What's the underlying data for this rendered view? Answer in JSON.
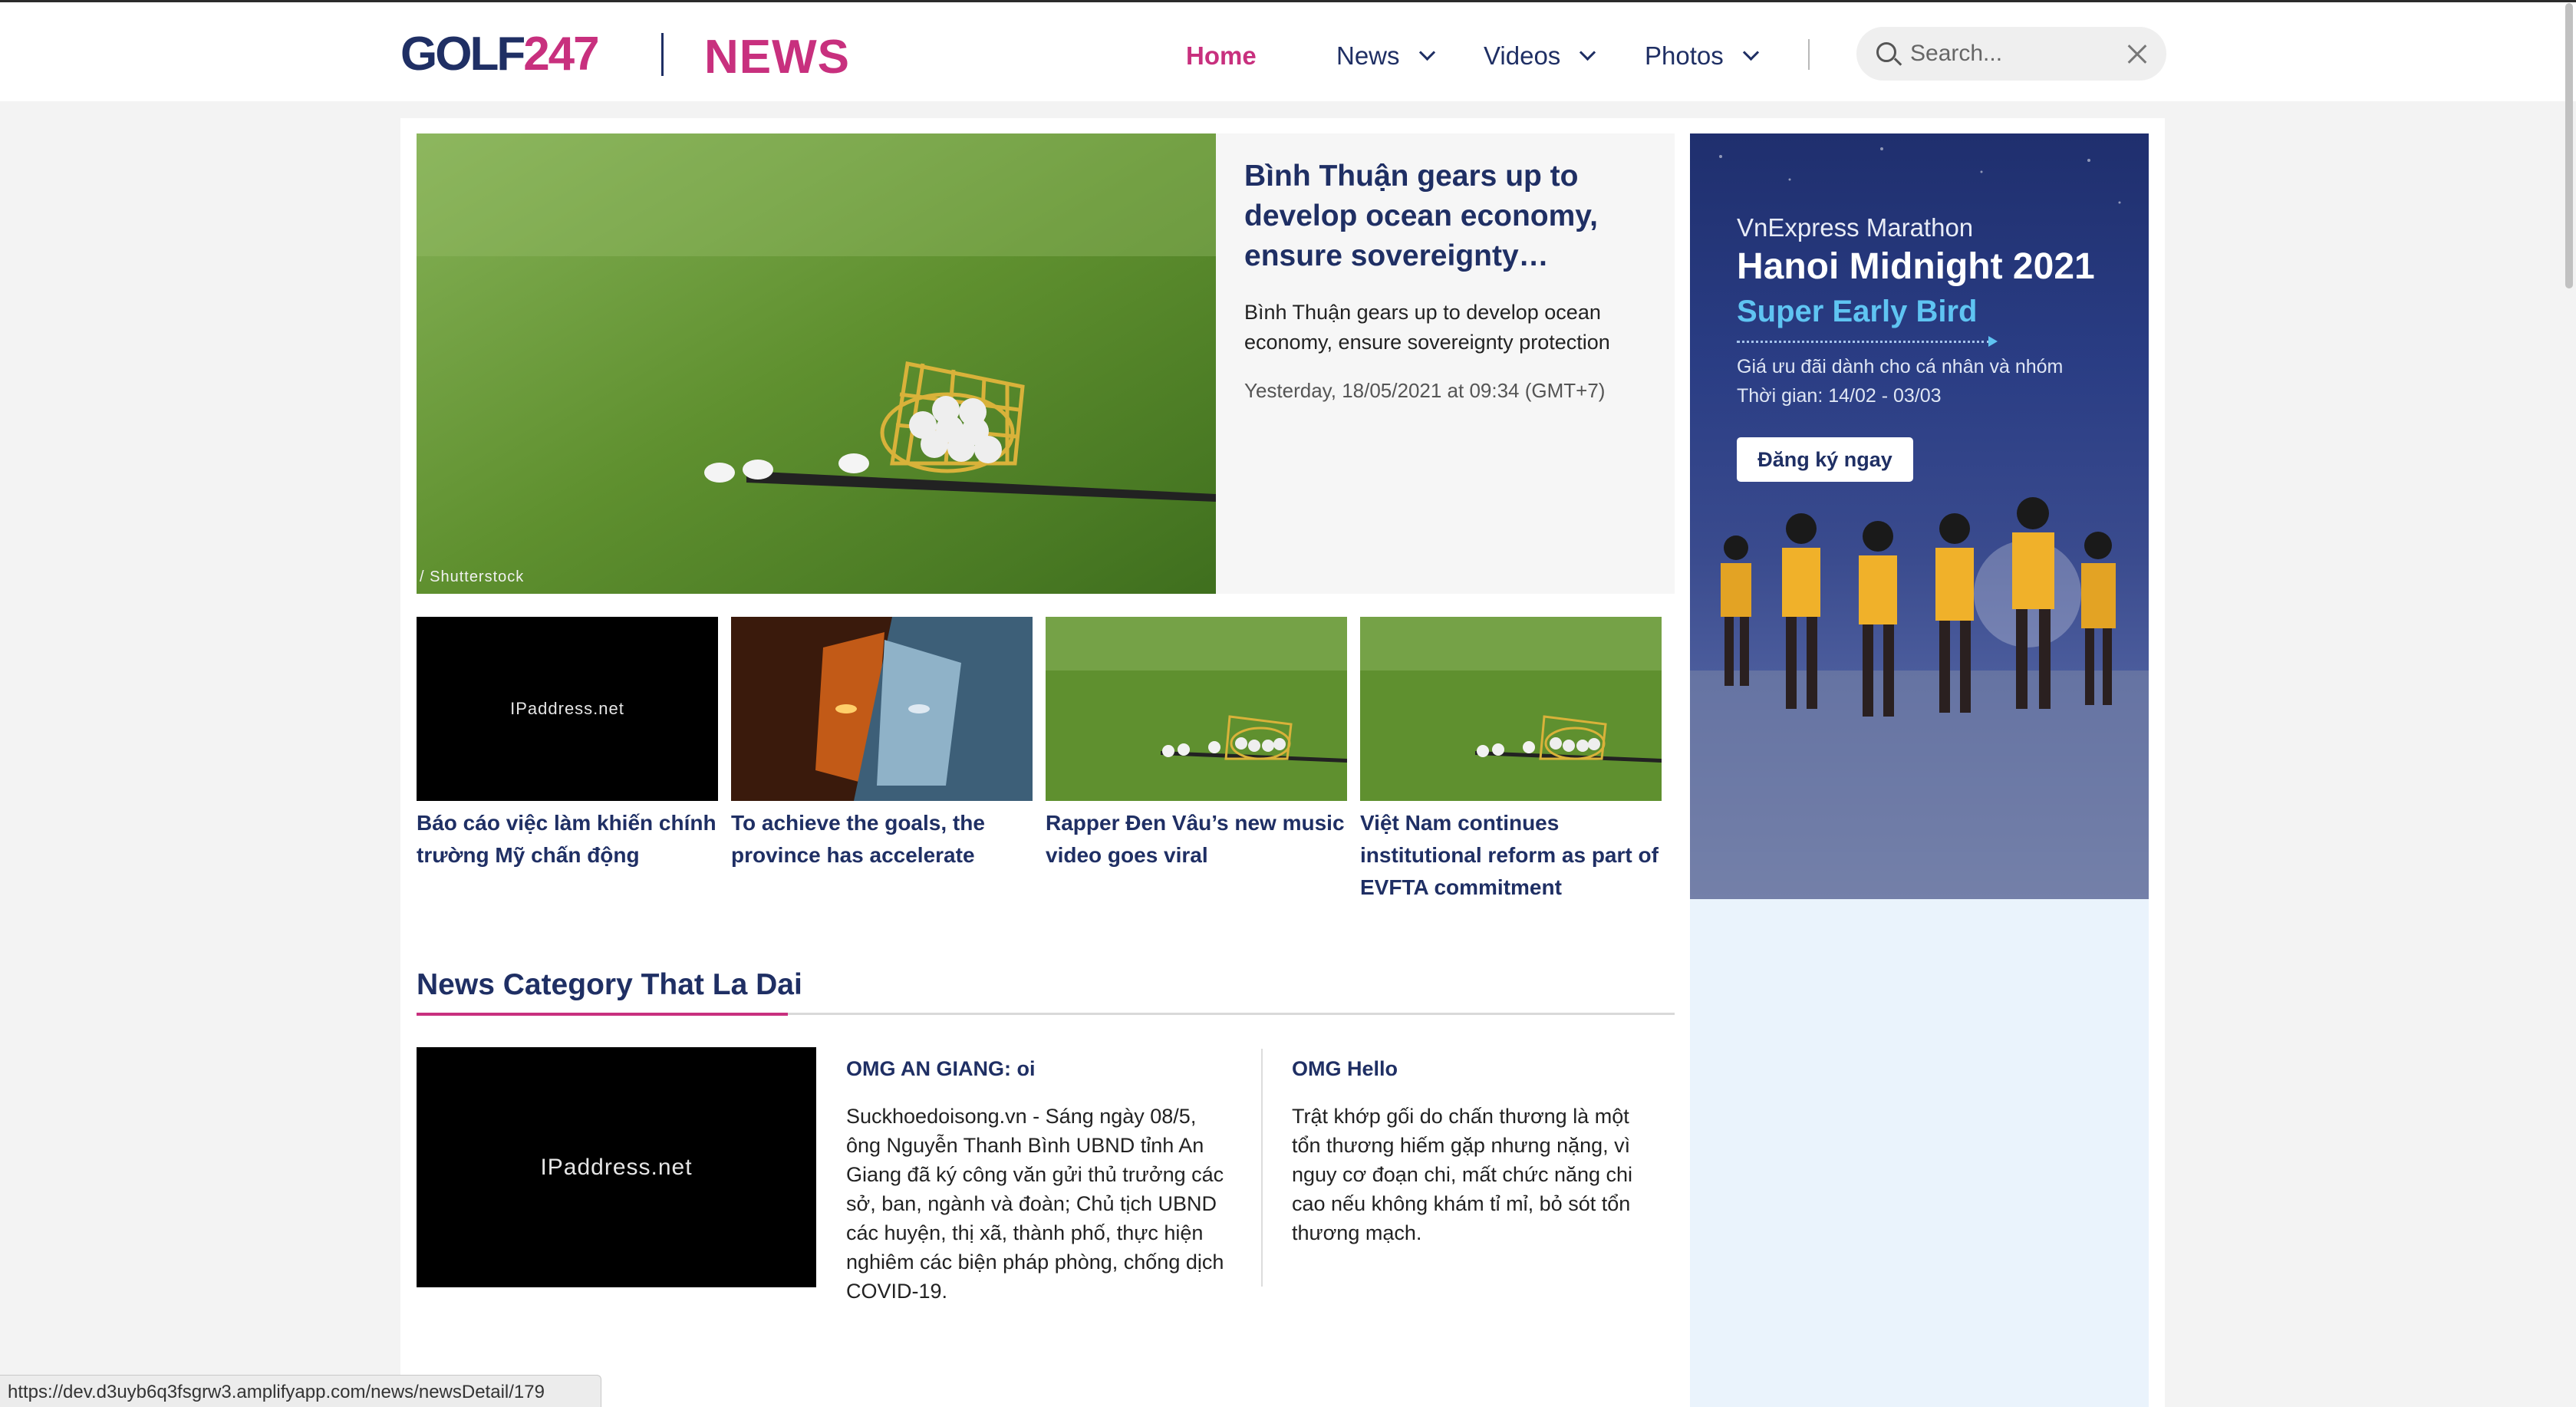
{
  "header": {
    "logo_golf": "GOLF",
    "logo_247": "247",
    "logo_news": "NEWS",
    "nav": [
      {
        "label": "Home",
        "active": true
      },
      {
        "label": "News",
        "dropdown": true
      },
      {
        "label": "Videos",
        "dropdown": true
      },
      {
        "label": "Photos",
        "dropdown": true
      }
    ],
    "search_placeholder": "Search..."
  },
  "hero": {
    "title": "Bình Thuận gears up to develop ocean economy, ensure sovereignty…",
    "description": "Bình Thuận gears up to develop ocean economy, ensure sovereignty protection",
    "date": "Yesterday, 18/05/2021 at 09:34 (GMT+7)",
    "image_caption": "/ Shutterstock"
  },
  "thumbs": [
    {
      "title": "Báo cáo việc làm khiến chính trường Mỹ chấn động",
      "image_text": "IPaddress.net"
    },
    {
      "title": "To achieve the goals, the province has accelerate"
    },
    {
      "title": "Rapper Đen Vâu’s new music video goes viral"
    },
    {
      "title": "Việt Nam continues institutional reform as part of EVFTA commitment"
    }
  ],
  "category": {
    "title": "News Category That La Dai",
    "image_text": "IPaddress.net",
    "items": [
      {
        "title": "OMG AN GIANG: oi",
        "body": "Suckhoedoisong.vn - Sáng ngày 08/5, ông Nguyễn Thanh Bình UBND tỉnh An Giang đã ký công văn gửi thủ trưởng các sở, ban, ngành và đoàn; Chủ tịch UBND các huyện, thị xã, thành phố, thực hiện nghiêm các biện pháp phòng, chống dịch COVID-19."
      },
      {
        "title": "OMG Hello",
        "body": "Trật khớp gối do chấn thương là một tổn thương hiếm gặp nhưng nặng, vì nguy cơ đoạn chi, mất chức năng chi cao nếu không khám tỉ mỉ, bỏ sót tổn thương mạch."
      }
    ]
  },
  "ad": {
    "subtitle": "VnExpress Marathon",
    "title": "Hanoi Midnight 2021",
    "highlight": "Super Early Bird",
    "line1": "Giá ưu đãi dành cho cá nhân và nhóm",
    "line2": "Thời gian: 14/02 - 03/03",
    "button": "Đăng ký ngay"
  },
  "status_url": "https://dev.d3uyb6q3fsgrw3.amplifyapp.com/news/newsDetail/179",
  "colors": {
    "brand_navy": "#1f2f64",
    "brand_pink": "#c8307e"
  }
}
